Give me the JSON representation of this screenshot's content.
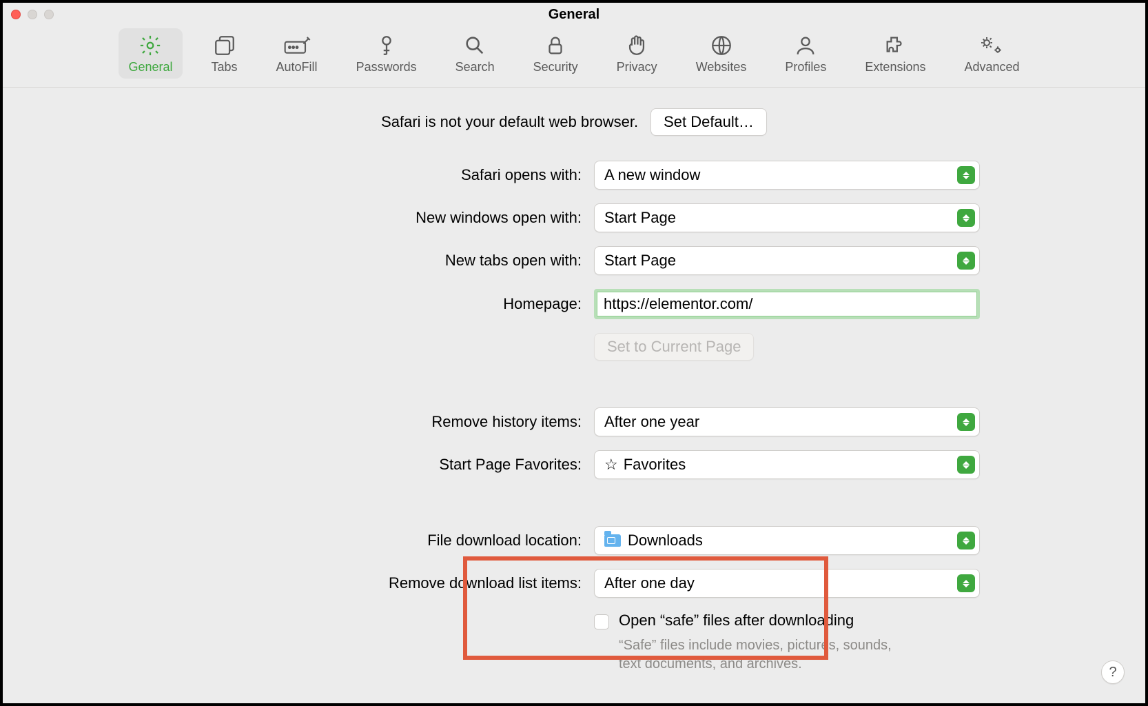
{
  "window": {
    "title": "General"
  },
  "tabs": [
    {
      "label": "General"
    },
    {
      "label": "Tabs"
    },
    {
      "label": "AutoFill"
    },
    {
      "label": "Passwords"
    },
    {
      "label": "Search"
    },
    {
      "label": "Security"
    },
    {
      "label": "Privacy"
    },
    {
      "label": "Websites"
    },
    {
      "label": "Profiles"
    },
    {
      "label": "Extensions"
    },
    {
      "label": "Advanced"
    }
  ],
  "defaults": {
    "notice": "Safari is not your default web browser.",
    "set_default_btn": "Set Default…"
  },
  "form": {
    "opens_with_label": "Safari opens with:",
    "opens_with_value": "A new window",
    "new_windows_label": "New windows open with:",
    "new_windows_value": "Start Page",
    "new_tabs_label": "New tabs open with:",
    "new_tabs_value": "Start Page",
    "homepage_label": "Homepage:",
    "homepage_value": "https://elementor.com/",
    "set_current_btn": "Set to Current Page",
    "remove_history_label": "Remove history items:",
    "remove_history_value": "After one year",
    "favorites_label": "Start Page Favorites:",
    "favorites_value": "Favorites",
    "download_loc_label": "File download location:",
    "download_loc_value": "Downloads",
    "remove_dl_label": "Remove download list items:",
    "remove_dl_value": "After one day",
    "open_safe_label": "Open “safe” files after downloading",
    "open_safe_desc": "“Safe” files include movies, pictures, sounds, text documents, and archives."
  },
  "help": "?"
}
